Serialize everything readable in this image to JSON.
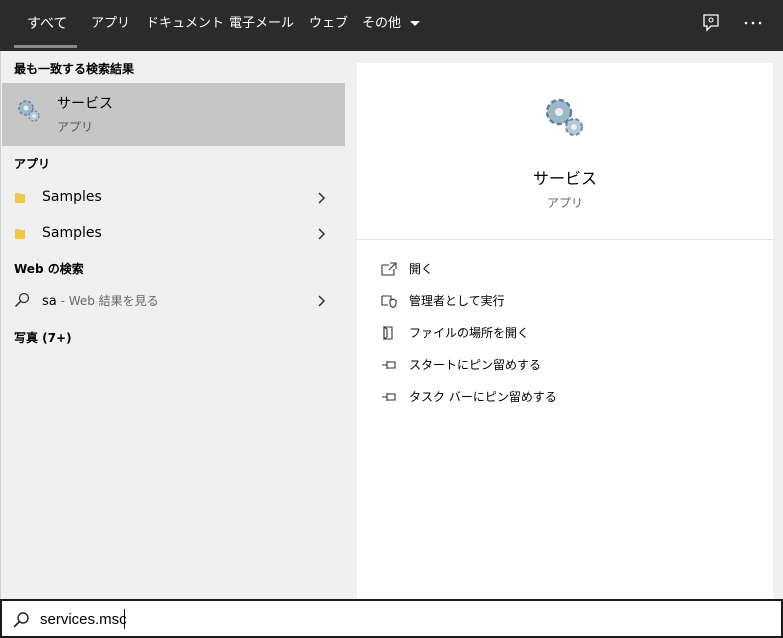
{
  "tabs": [
    {
      "label": "すべて",
      "active": true
    },
    {
      "label": "アプリ"
    },
    {
      "label": "ドキュメント"
    },
    {
      "label": "電子メール"
    },
    {
      "label": "ウェブ"
    },
    {
      "label": "その他"
    }
  ],
  "toolbar_icons": [
    "feedback-icon",
    "more-options-icon"
  ],
  "left": {
    "best_match_title": "最も一致する検索結果",
    "best_match": {
      "name": "サービス",
      "type": "アプリ",
      "icon": "gears-icon"
    },
    "apps_title": "アプリ",
    "apps": [
      {
        "label": "Samples",
        "icon": "folder-icon"
      },
      {
        "label": "Samples",
        "icon": "folder-icon"
      }
    ],
    "web_title": "Web の検索",
    "web": {
      "query": "sa",
      "suffix": " - Web 結果を見る"
    },
    "photos_title": "写真 (7+)"
  },
  "right": {
    "name": "サービス",
    "type": "アプリ",
    "actions": [
      {
        "label": "開く",
        "icon": "open-icon"
      },
      {
        "label": "管理者として実行",
        "icon": "shield-icon"
      },
      {
        "label": "ファイルの場所を開く",
        "icon": "file-location-icon"
      },
      {
        "label": "スタートにピン留めする",
        "icon": "pin-icon"
      },
      {
        "label": "タスク バーにピン留めする",
        "icon": "pin-icon"
      }
    ]
  },
  "search": {
    "value": "services.msc",
    "icon": "search-icon"
  },
  "colors": {
    "topbar": "#2b2b2b",
    "selected_row": "#c6c6c6",
    "pane_bg": "#f0f0f0"
  }
}
